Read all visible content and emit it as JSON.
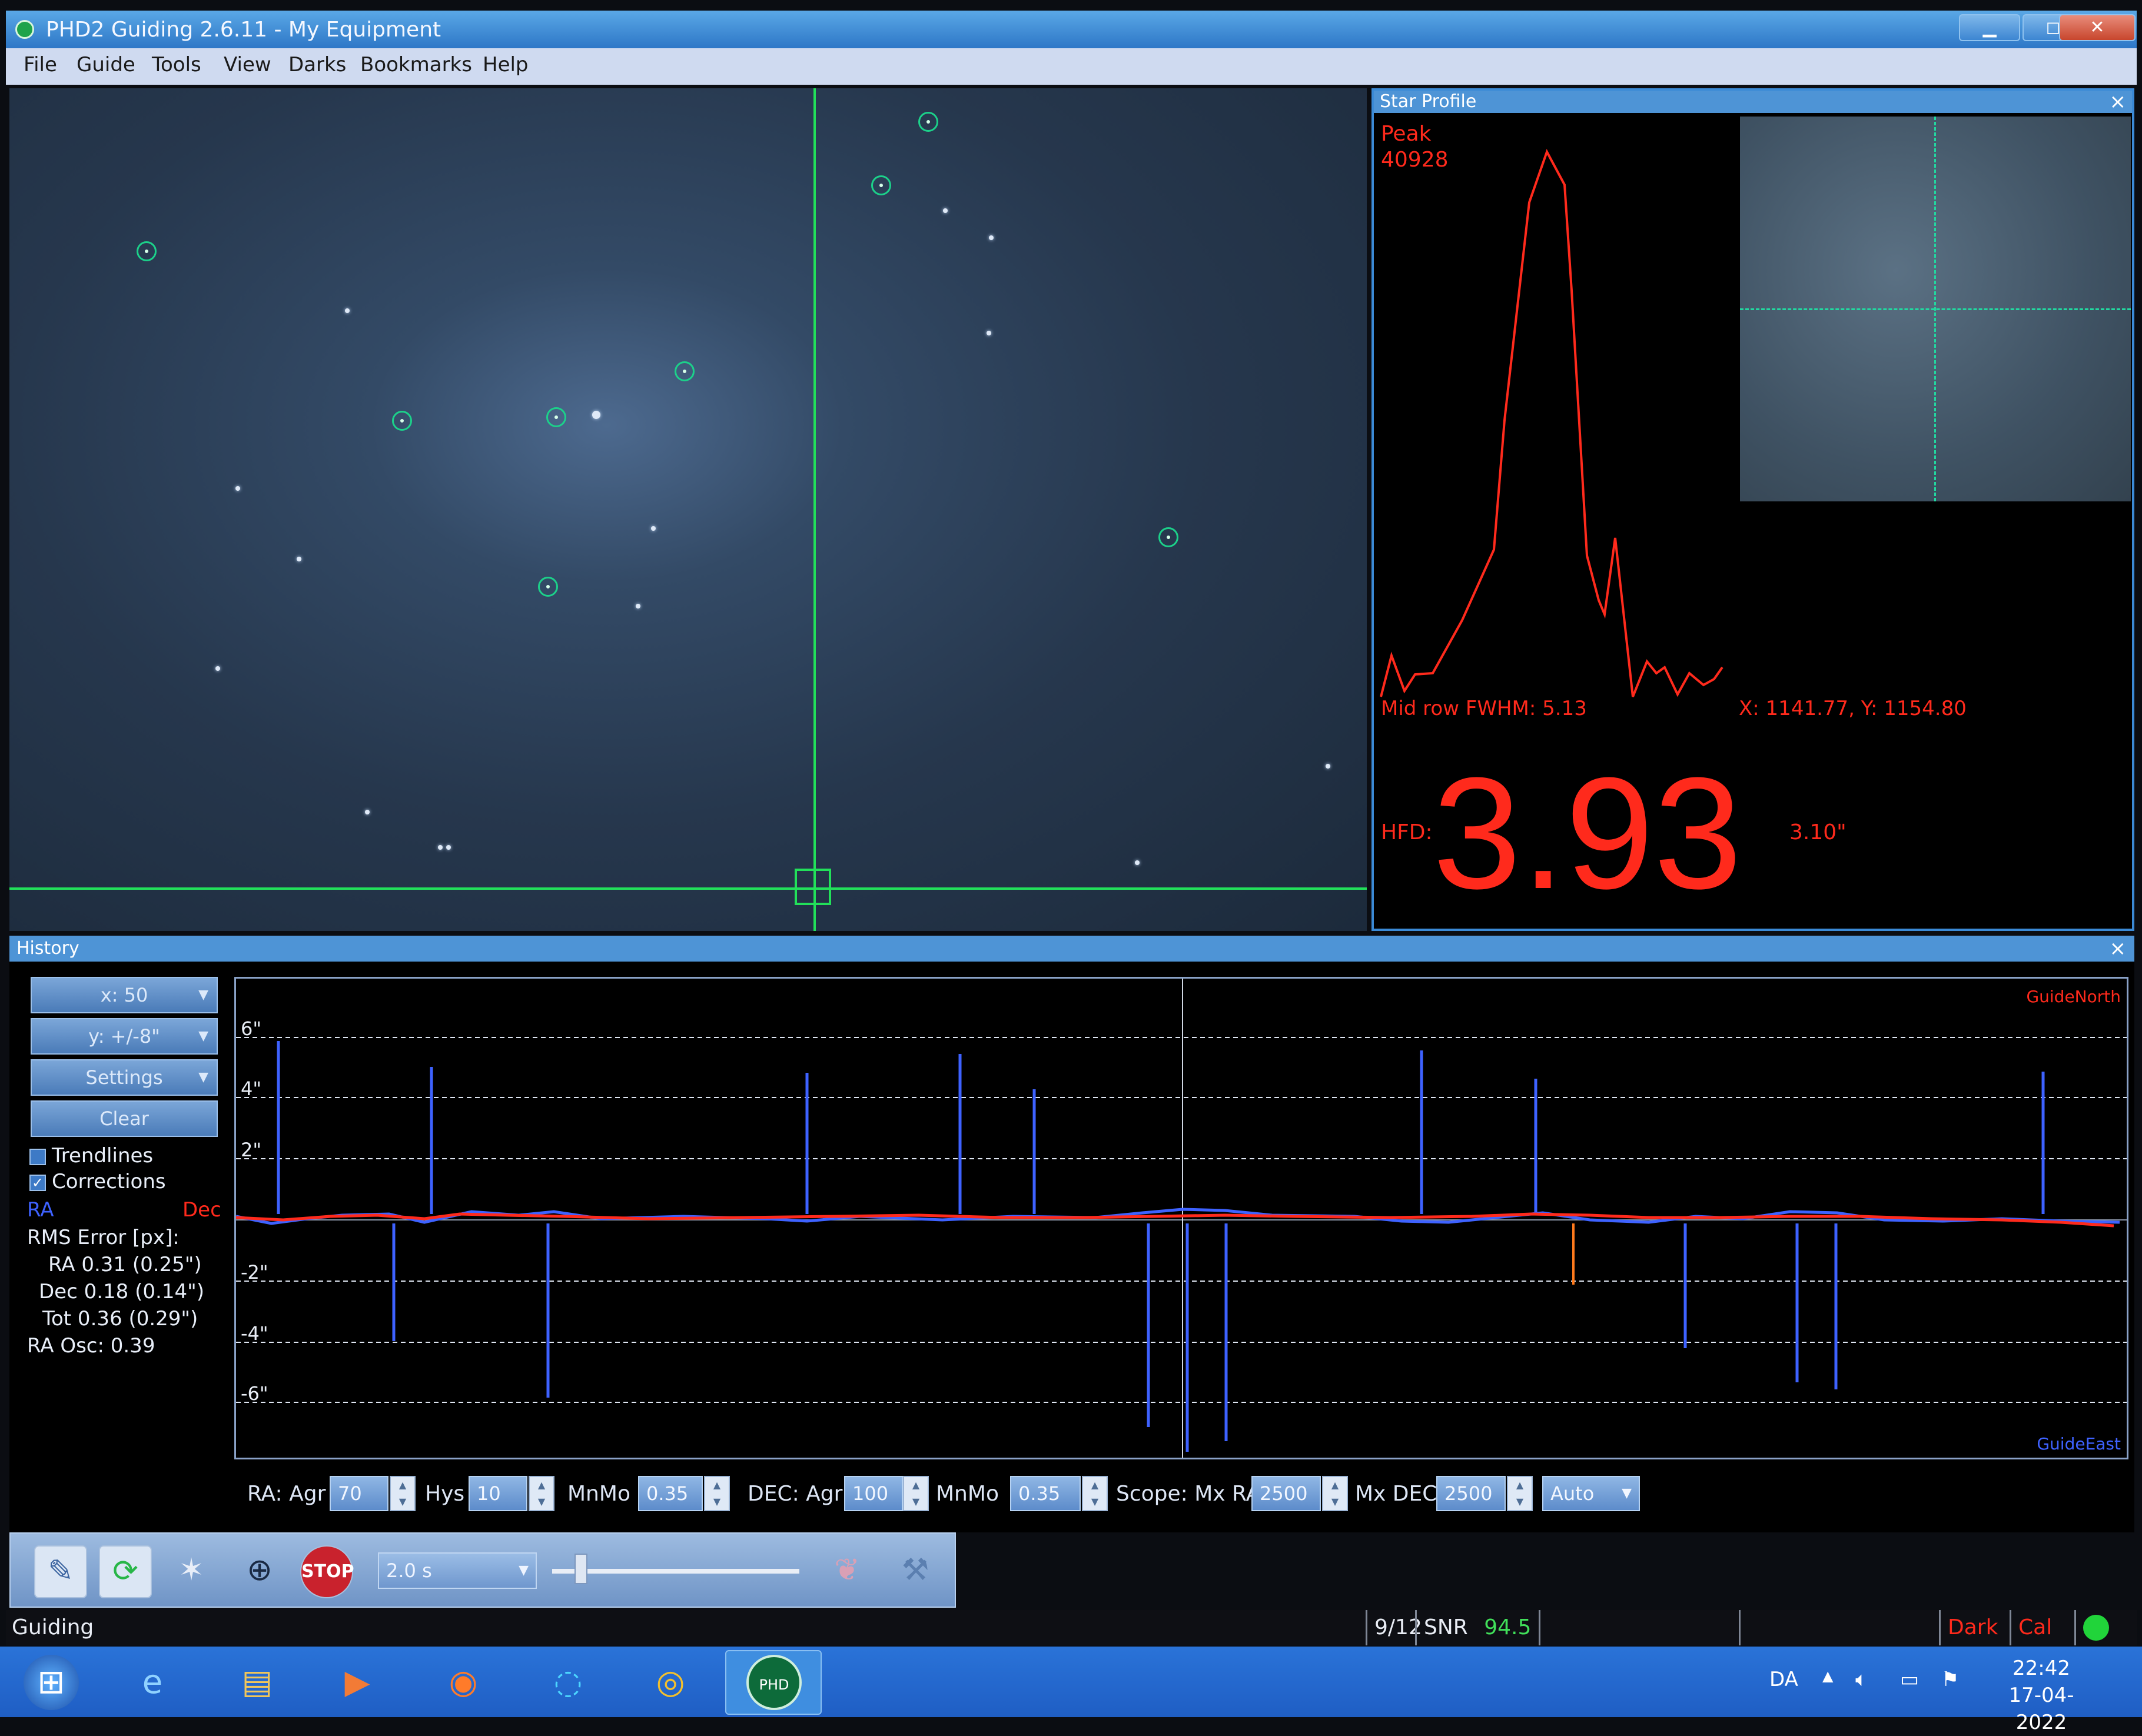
{
  "window": {
    "title": "PHD2 Guiding 2.6.11 - My Equipment",
    "controls": [
      "▁",
      "◻",
      "✕"
    ]
  },
  "menu": [
    "File",
    "Guide",
    "Tools",
    "View",
    "Darks",
    "Bookmarks",
    "Help"
  ],
  "star_profile": {
    "panel_title": "Star Profile",
    "close": "×",
    "peak_label": "Peak",
    "peak_value": "40928",
    "fwhm": "Mid row FWHM: 5.13",
    "position": "X: 1141.77, Y: 1154.80",
    "hfd_label": "HFD:",
    "hfd_value": "3.93",
    "hfd_arcsec": "3.10\""
  },
  "history": {
    "panel_title": "History",
    "close": "×",
    "x_scale": "x: 50",
    "y_scale": "y: +/-8\"",
    "settings": "Settings",
    "clear": "Clear",
    "trendlines": "Trendlines",
    "corrections": "Corrections",
    "legend_ra": "RA",
    "legend_dec": "Dec",
    "rms_title": "RMS Error [px]:",
    "rms_ra": "RA 0.31 (0.25\")",
    "rms_dec": "Dec 0.18 (0.14\")",
    "rms_tot": "Tot 0.36 (0.29\")",
    "ra_osc": "RA Osc: 0.39",
    "graph_label_top": "GuideNorth",
    "graph_label_bottom": "GuideEast",
    "y_ticks": [
      "6\"",
      "4\"",
      "2\"",
      "-2\"",
      "-4\"",
      "-6\""
    ]
  },
  "tuning": {
    "ra_agr_label": "RA: Agr",
    "ra_agr": "70",
    "hys_label": "Hys",
    "hys": "10",
    "ra_mnmo_label": "MnMo",
    "ra_mnmo": "0.35",
    "dec_agr_label": "DEC: Agr",
    "dec_agr": "100",
    "dec_mnmo_label": "MnMo",
    "dec_mnmo": "0.35",
    "scope_mxra_label": "Scope: Mx RA",
    "scope_mxra": "2500",
    "mxdec_label": "Mx DEC",
    "mxdec": "2500",
    "dec_mode": "Auto"
  },
  "toolbar": {
    "exposure": "2.0 s",
    "stop_label": "STOP"
  },
  "status": {
    "state": "Guiding",
    "frame": "9/12",
    "snr_label": "SNR",
    "snr_value": "94.5",
    "dark": "Dark",
    "cal": "Cal"
  },
  "taskbar": {
    "lang": "DA",
    "time": "22:42",
    "date": "17-04-2022",
    "phd_icon_text": "PHD"
  },
  "colors": {
    "ra": "#3e62ff",
    "dec": "#ff2a1c",
    "crosshair": "#22e05a",
    "accent": "#4e94d6",
    "snr": "#41e05a",
    "status_ok": "#21d43a"
  }
}
